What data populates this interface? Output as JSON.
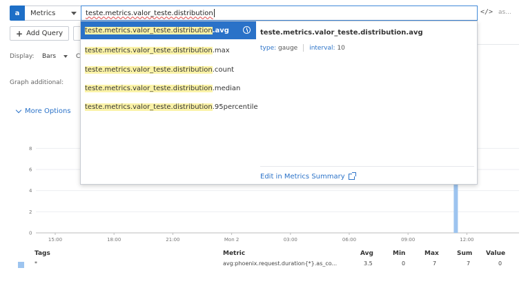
{
  "query": {
    "letter": "a",
    "source": "Metrics",
    "input_value": "teste.metrics.valor_teste.distribution",
    "code_icon": "</>",
    "as_text": "as..."
  },
  "toolbar": {
    "add_query_label": "Add Query"
  },
  "display": {
    "label": "Display:",
    "value": "Bars",
    "stub": "C"
  },
  "graph_additional_label": "Graph additional:",
  "more_options_label": "More Options",
  "autocomplete": {
    "typed": "teste.metrics.valor_teste.distribution",
    "suggestions": [
      {
        "prefix": "teste.metrics.valor_teste.distribution",
        "suffix": ".avg",
        "selected": true
      },
      {
        "prefix": "teste.metrics.valor_teste.distribution",
        "suffix": ".max",
        "selected": false
      },
      {
        "prefix": "teste.metrics.valor_teste.distribution",
        "suffix": ".count",
        "selected": false
      },
      {
        "prefix": "teste.metrics.valor_teste.distribution",
        "suffix": ".median",
        "selected": false
      },
      {
        "prefix": "teste.metrics.valor_teste.distribution",
        "suffix": ".95percentile",
        "selected": false
      }
    ],
    "detail": {
      "title": "teste.metrics.valor_teste.distribution.avg",
      "type_key": "type:",
      "type_val": "gauge",
      "interval_key": "interval:",
      "interval_val": "10",
      "edit_link": "Edit in Metrics Summary"
    }
  },
  "chart_data": {
    "type": "bar",
    "y_ticks": [
      "0",
      "2",
      "4",
      "6",
      "8"
    ],
    "x_ticks": [
      "15:00",
      "18:00",
      "21:00",
      "Mon 2",
      "03:00",
      "06:00",
      "09:00",
      "12:00"
    ],
    "ylim": [
      0,
      9
    ],
    "bar": {
      "x_position": "just before 12:00",
      "value": 7
    },
    "bar_color": "#9dc4ef"
  },
  "legend": {
    "headers": {
      "tags": "Tags",
      "metric": "Metric",
      "avg": "Avg",
      "min": "Min",
      "max": "Max",
      "sum": "Sum",
      "value": "Value"
    },
    "rows": [
      {
        "tags": "*",
        "metric": "avg:phoenix.request.duration{*}.as_co...",
        "avg": "3.5",
        "min": "0",
        "max": "7",
        "sum": "7",
        "value": "0"
      }
    ]
  }
}
